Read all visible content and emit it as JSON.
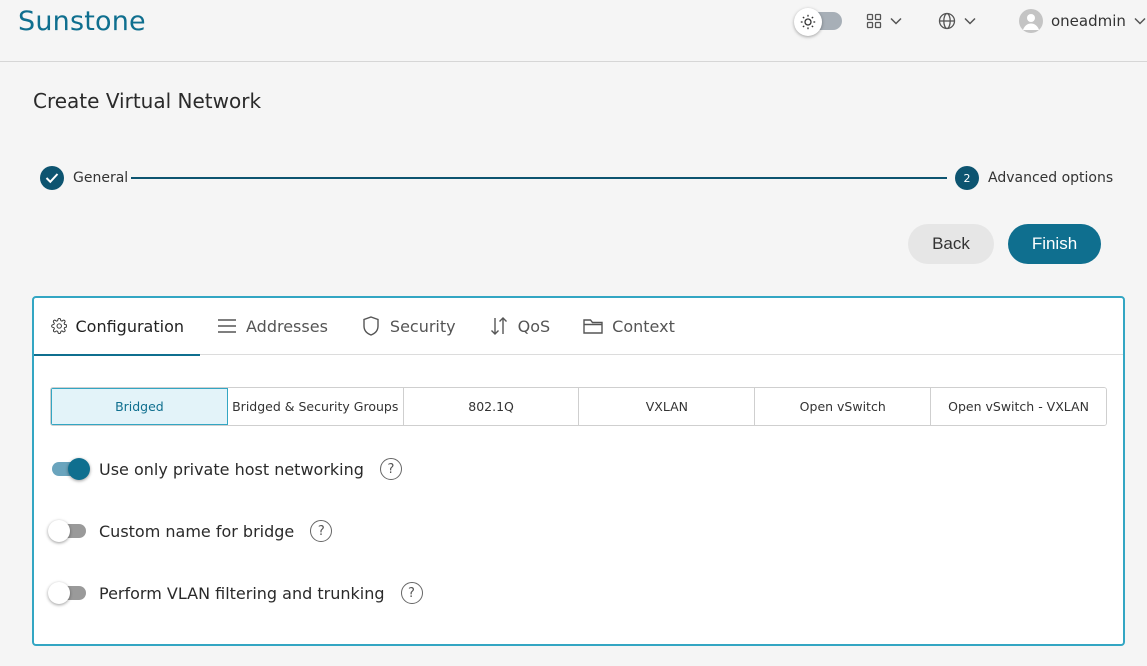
{
  "header": {
    "brand": "Sunstone",
    "username": "oneadmin",
    "icons": [
      "sun-icon",
      "apps-grid-icon",
      "globe-icon",
      "user-avatar-icon",
      "chevron-down-icon"
    ]
  },
  "page": {
    "title": "Create Virtual Network"
  },
  "stepper": {
    "steps": [
      {
        "label": "General",
        "state": "completed"
      },
      {
        "number": "2",
        "label": "Advanced options",
        "state": "active"
      }
    ]
  },
  "actions": {
    "back": "Back",
    "finish": "Finish"
  },
  "tabs": [
    {
      "label": "Configuration",
      "icon": "gear-icon",
      "active": true
    },
    {
      "label": "Addresses",
      "icon": "list-icon"
    },
    {
      "label": "Security",
      "icon": "shield-icon"
    },
    {
      "label": "QoS",
      "icon": "sort-arrows-icon"
    },
    {
      "label": "Context",
      "icon": "folder-icon"
    }
  ],
  "modes": {
    "items": [
      "Bridged",
      "Bridged & Security Groups",
      "802.1Q",
      "VXLAN",
      "Open vSwitch",
      "Open vSwitch - VXLAN"
    ],
    "selected": "Bridged"
  },
  "options": [
    {
      "label": "Use only private host networking",
      "enabled": true
    },
    {
      "label": "Custom name for bridge",
      "enabled": false
    },
    {
      "label": "Perform VLAN filtering and trunking",
      "enabled": false
    }
  ],
  "help_symbol": "?",
  "colors": {
    "brand": "#0f6f8f",
    "step": "#0d5470",
    "panel_border": "#33a6c3",
    "selected_mode_bg": "#e3f3f9"
  }
}
